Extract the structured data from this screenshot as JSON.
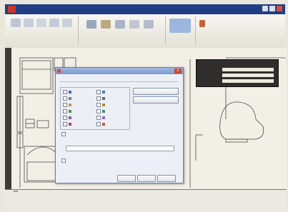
{
  "window": {
    "menus": [
      "",
      "",
      "",
      "",
      "",
      "",
      "",
      "",
      "",
      "",
      ""
    ]
  },
  "ribbon": {
    "groups": [
      "",
      "",
      ""
    ]
  },
  "leftbar": {
    "labels": [
      "",
      "",
      ""
    ]
  },
  "dialog": {
    "title": "",
    "subtitle": "",
    "group_label": "",
    "items_left": [
      "",
      "",
      "",
      "",
      "",
      ""
    ],
    "items_right": [
      "",
      "",
      "",
      "",
      "",
      ""
    ],
    "side_buttons": [
      "",
      ""
    ],
    "option1": "",
    "option2_label": "",
    "option3": "",
    "buttons": [
      "",
      "",
      ""
    ]
  },
  "properties": {
    "title": "",
    "rows": [
      {
        "label": "",
        "value": ""
      },
      {
        "label": "",
        "value": ""
      },
      {
        "label": "",
        "value": ""
      }
    ]
  },
  "command": {
    "tabs": [
      "",
      "",
      ""
    ],
    "lines": [
      "",
      ""
    ]
  },
  "colors": {
    "title_bar": "#1f3f82",
    "dialog_title": "#7a98cc",
    "canvas": "#f2efe6",
    "panel_dark": "#2f2e2c"
  }
}
